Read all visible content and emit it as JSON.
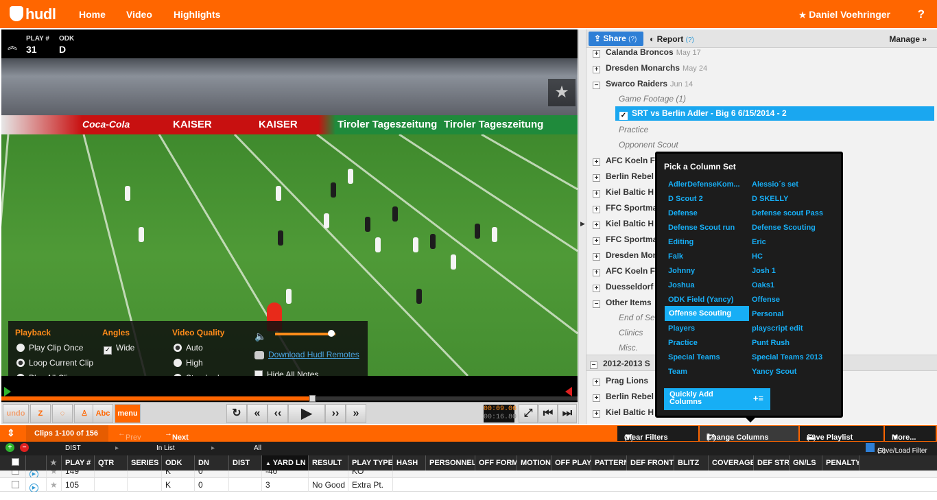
{
  "topbar": {
    "logo": "hudl",
    "nav": [
      "Home",
      "Video",
      "Highlights"
    ],
    "user": "Daniel Voehringer",
    "help": "?"
  },
  "video": {
    "play_label": "PLAY #",
    "play_value": "31",
    "odk_label": "ODK",
    "odk_value": "D",
    "banners": [
      "Coca-Cola",
      "KAISER",
      "Tiroler Tageszeitung"
    ]
  },
  "settings": {
    "playback_title": "Playback",
    "playback_options": [
      "Play Clip Once",
      "Loop Current Clip",
      "Play All Clips"
    ],
    "playback_selected": "Loop Current Clip",
    "angles_title": "Angles",
    "angle": "Wide",
    "quality_title": "Video Quality",
    "quality_options": [
      "Auto",
      "High",
      "Standard"
    ],
    "quality_selected": "Auto",
    "volume": 0.85,
    "download_link": "Download Hudl Remotes",
    "hide_notes": "Hide All Notes"
  },
  "timeline": {
    "progress": 0.54
  },
  "toolbar": {
    "undo": "undo",
    "abc": "Abc",
    "menu": "menu",
    "time_current": "00:09.06",
    "time_total": "00:16.80"
  },
  "rpanel": {
    "share": "Share",
    "report": "Report",
    "q": "(?)",
    "manage": "Manage »",
    "tree": [
      {
        "name": "Calanda Broncos",
        "date": "May 17",
        "expander": "+"
      },
      {
        "name": "Dresden Monarchs",
        "date": "May 24",
        "expander": "+"
      },
      {
        "name": "Swarco Raiders",
        "date": "Jun 14",
        "expander": "−"
      }
    ],
    "game_footage": "Game Footage (1)",
    "selected_item": "SRT vs Berlin Adler - Big 6 6/15/2014 - 2",
    "practice": "Practice",
    "opponent_scout": "Opponent Scout",
    "tree2": [
      {
        "name": "AFC Koeln F",
        "expander": "+"
      },
      {
        "name": "Berlin Rebel",
        "expander": "+"
      },
      {
        "name": "Kiel Baltic H",
        "expander": "+"
      },
      {
        "name": "FFC Sportma",
        "expander": "+"
      },
      {
        "name": "Kiel Baltic H",
        "expander": "+"
      },
      {
        "name": "FFC Sportma",
        "expander": "+"
      },
      {
        "name": "Dresden Mon",
        "expander": "+"
      },
      {
        "name": "AFC Koeln F",
        "expander": "+"
      },
      {
        "name": "Duesseldorf",
        "expander": "+"
      },
      {
        "name": "Other Items",
        "expander": "−"
      }
    ],
    "other_items_children": [
      "End of Se",
      "Clinics",
      "Misc."
    ],
    "season": "2012-2013 S",
    "tree3": [
      {
        "name": "Prag Lions",
        "expander": "+"
      },
      {
        "name": "Berlin Rebel",
        "expander": "+"
      },
      {
        "name": "Kiel Baltic H",
        "expander": "+"
      }
    ]
  },
  "picker": {
    "title": "Pick a Column Set",
    "left": [
      "AdlerDefenseKom...",
      "D Scout 2",
      "Defense",
      "Defense Scout run",
      "Editing",
      "Falk",
      "Johnny",
      "Joshua",
      "ODK Field (Yancy)",
      "Offense Scouting",
      "Players",
      "Practice",
      "Special Teams",
      "Team"
    ],
    "right": [
      "Alessio´s set",
      "D SKELLY",
      "Defense scout Pass",
      "Defense Scouting",
      "Eric",
      "HC",
      "Josh 1",
      "Oaks1",
      "Offense",
      "Personal",
      "playscript edit",
      "Punt Rush",
      "Special Teams 2013",
      "Yancy Scout"
    ],
    "selected": "Offense Scouting",
    "quick_add": "Quickly Add Columns"
  },
  "clipbar": {
    "clips": "Clips 1-100 of 156",
    "prev": "Prev",
    "next": "Next",
    "clear_filters": "Clear Filters",
    "change_columns": "Change Columns",
    "save_playlist": "Save Playlist",
    "more": "More...",
    "q": "(?)"
  },
  "filters": {
    "dist": "DIST",
    "in_list": "In List",
    "all": "All",
    "save_load": "Save/Load Filter",
    "q": "(?)"
  },
  "columns": [
    "PLAY #",
    "QTR",
    "SERIES",
    "ODK",
    "DN",
    "DIST",
    "YARD LN",
    "RESULT",
    "PLAY TYPE",
    "HASH",
    "PERSONNEL",
    "OFF FORM",
    "MOTION",
    "OFF PLAY",
    "PATTERN",
    "DEF FRONT",
    "BLITZ",
    "COVERAGE",
    "DEF STR",
    "GN/LS",
    "PENALTY"
  ],
  "sorted_column": "YARD LN",
  "rows": [
    {
      "play": "149",
      "qtr": "",
      "series": "",
      "odk": "K",
      "dn": "0",
      "dist": "",
      "yard": "-40",
      "result": "",
      "type": "KO"
    },
    {
      "play": "105",
      "qtr": "",
      "series": "",
      "odk": "K",
      "dn": "0",
      "dist": "",
      "yard": "3",
      "result": "No Good",
      "type": "Extra Pt."
    }
  ],
  "colors": {
    "brand": "#ff6600",
    "accent": "#17aef5"
  }
}
